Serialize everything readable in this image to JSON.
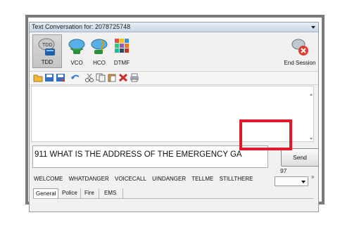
{
  "window": {
    "title": "Text Conversation for: 2078725748"
  },
  "ribbon": {
    "tdd_label": "TDD",
    "vco_label": "VCO",
    "hco_label": "HCO",
    "dtmf_label": "DTMF",
    "end_session_label": "End Session"
  },
  "message": {
    "text": "911 WHAT IS THE ADDRESS OF THE EMERGENCY GA"
  },
  "send": {
    "label": "Send",
    "char_count": "97"
  },
  "quick_phrases": [
    "WELCOME",
    "WHATDANGER",
    "VOICECALL",
    "UINDANGER",
    "TELLME",
    "STILLTHERE"
  ],
  "more_chevron": "»",
  "tabs": [
    "General",
    "Police",
    "Fire",
    "EMS"
  ],
  "highlight_color": "#e0192b"
}
